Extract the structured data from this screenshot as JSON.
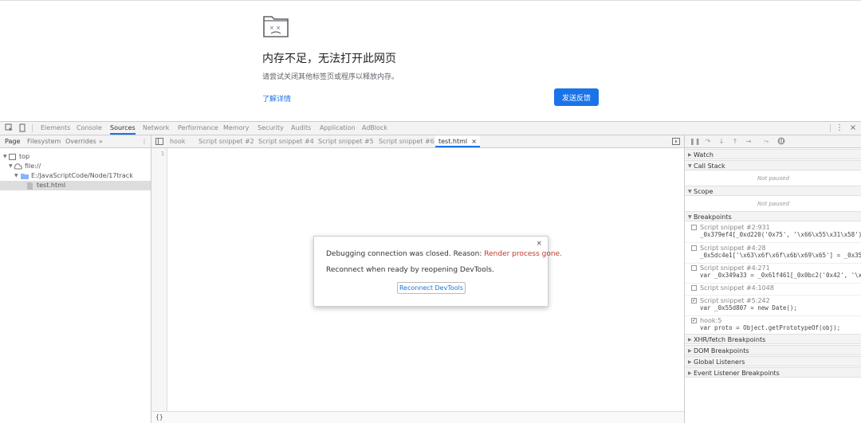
{
  "crash_page": {
    "title": "内存不足，无法打开此网页",
    "subtitle": "请尝试关闭其他标签页或程序以释放内存。",
    "learn_more": "了解详情",
    "feedback_button": "发送反馈"
  },
  "devtools": {
    "main_tabs": [
      "Elements",
      "Console",
      "Sources",
      "Network",
      "Performance",
      "Memory",
      "Security",
      "Audits",
      "Application",
      "AdBlock"
    ],
    "active_tab": "Sources",
    "navigator": {
      "tabs": [
        "Page",
        "Filesystem",
        "Overrides"
      ],
      "more": "»",
      "tree": [
        {
          "label": "top"
        },
        {
          "label": "file://"
        },
        {
          "label": "E:/JavaScriptCode/Node/17track"
        },
        {
          "label": "test.html"
        }
      ]
    },
    "editor": {
      "tabs": [
        "hook",
        "Script snippet #2",
        "Script snippet #4",
        "Script snippet #5",
        "Script snippet #6",
        "test.html"
      ],
      "active_tab": "test.html",
      "line_number": "1",
      "format_button": "{}"
    },
    "debugger": {
      "watch": "Watch",
      "call_stack": "Call Stack",
      "not_paused_1": "Not paused",
      "scope": "Scope",
      "not_paused_2": "Not paused",
      "breakpoints": "Breakpoints",
      "breakpoint_items": [
        {
          "location": "Script snippet #2:931",
          "code": "_0x379ef4[_0xd220('0x75', '\\x66\\x55\\x31\\x58')]…",
          "checked": false
        },
        {
          "location": "Script snippet #4:28",
          "code": "_0x5dc4e1['\\x63\\x6f\\x6f\\x6b\\x69\\x65'] = _0x356…",
          "checked": false
        },
        {
          "location": "Script snippet #4:271",
          "code": "var _0x349a33 = _0x61f461[_0x0bc2('0x42', '\\x6…",
          "checked": false
        },
        {
          "location": "Script snippet #4:1048",
          "code": "",
          "checked": false
        },
        {
          "location": "Script snippet #5:242",
          "code": "var _0x55d807 = new Date();",
          "checked": true
        },
        {
          "location": "hook:5",
          "code": "var proto = Object.getPrototypeOf(obj);",
          "checked": true
        }
      ],
      "xhr_breakpoints": "XHR/fetch Breakpoints",
      "dom_breakpoints": "DOM Breakpoints",
      "global_listeners": "Global Listeners",
      "event_listener_breakpoints": "Event Listener Breakpoints"
    },
    "dialog": {
      "message_prefix": "Debugging connection was closed. Reason: ",
      "reason": "Render process gone.",
      "message_2": "Reconnect when ready by reopening DevTools.",
      "reconnect_button": "Reconnect DevTools",
      "close": "×"
    },
    "close_icon": "×",
    "more_icon": "⋮"
  },
  "colors": {
    "accent": "#1a73e8",
    "reason": "#c0392b"
  }
}
